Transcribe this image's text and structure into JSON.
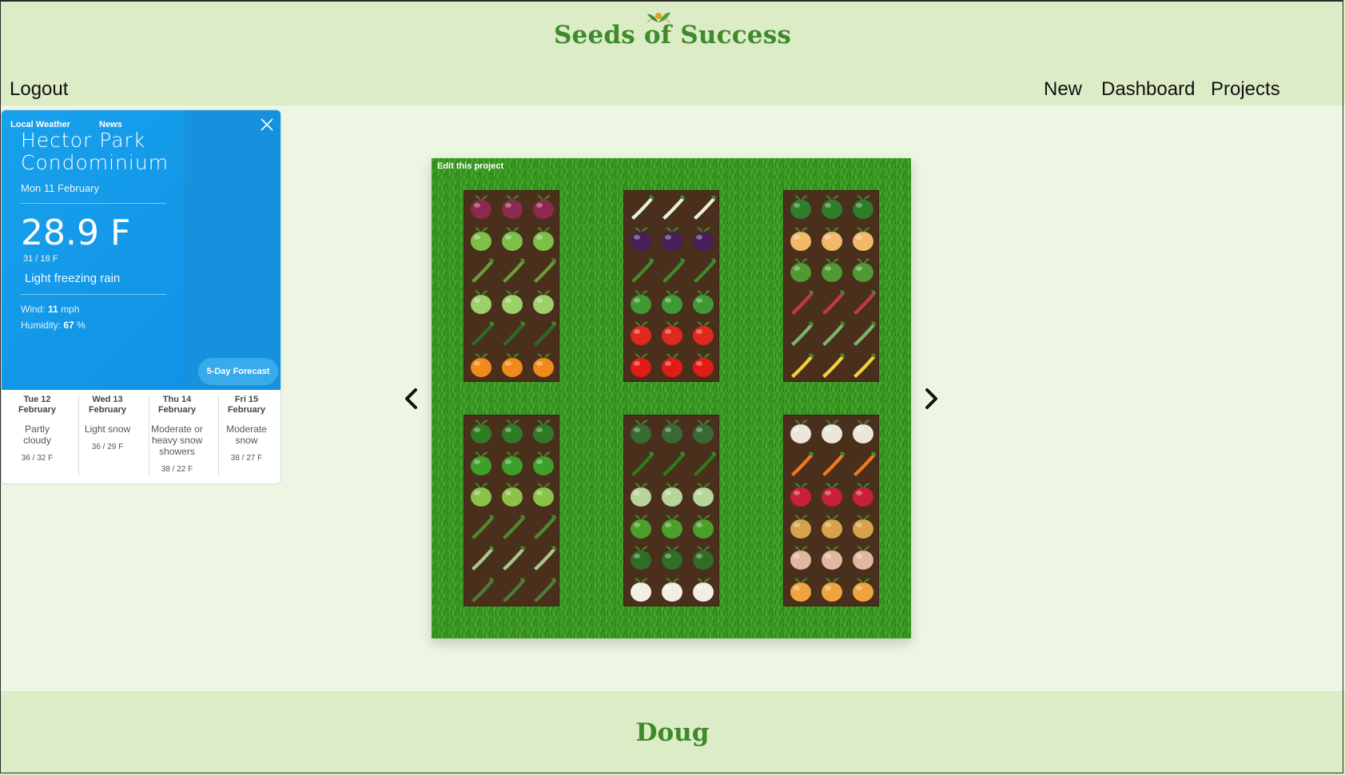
{
  "header": {
    "logo_text": "Seeds of Success",
    "nav": {
      "logout": "Logout",
      "new": "New",
      "dashboard": "Dashboard",
      "projects": "Projects"
    }
  },
  "weather": {
    "tabs": [
      "Local Weather",
      "News"
    ],
    "location": "Hector Park Condominium",
    "date": "Mon 11 February",
    "temperature": "28.9 F",
    "range": "31 / 18 F",
    "condition": "Light freezing rain",
    "wind_label": "Wind:",
    "wind_value": "11",
    "wind_unit": "mph",
    "humidity_label": "Humidity:",
    "humidity_value": "67",
    "humidity_unit": "%",
    "forecast_button": "5-Day Forecast",
    "forecast": [
      {
        "day": "Tue 12",
        "month": "February",
        "condition": "Partly cloudy",
        "range": "36 / 32 F"
      },
      {
        "day": "Wed 13",
        "month": "February",
        "condition": "Light snow",
        "range": "36 / 29 F"
      },
      {
        "day": "Thu 14",
        "month": "February",
        "condition": "Moderate or heavy snow showers",
        "range": "38 / 22 F"
      },
      {
        "day": "Fri 15",
        "month": "February",
        "condition": "Moderate snow",
        "range": "38 / 27 F"
      }
    ]
  },
  "project": {
    "edit_label": "Edit this project",
    "beds": [
      {
        "rows": [
          "beet",
          "bok-choy",
          "asparagus",
          "cabbage",
          "zucchini",
          "pumpkin"
        ]
      },
      {
        "rows": [
          "leek",
          "eggplant",
          "okra",
          "pea",
          "tomato",
          "bell-pepper"
        ]
      },
      {
        "rows": [
          "watermelon",
          "cantaloupe",
          "lettuce",
          "rhubarb",
          "chard",
          "corn"
        ]
      },
      {
        "rows": [
          "spinach",
          "basil",
          "leaf-lettuce",
          "parsley",
          "fennel",
          "rosemary"
        ]
      },
      {
        "rows": [
          "kale",
          "cucumber",
          "savoy-cabbage",
          "arugula",
          "broccoli",
          "cauliflower"
        ]
      },
      {
        "rows": [
          "garlic",
          "carrot",
          "radish",
          "potato",
          "ginger",
          "onion"
        ]
      }
    ],
    "colors": {
      "beet": "#8b2a4c",
      "bok-choy": "#7cc04a",
      "asparagus": "#6f9a3a",
      "cabbage": "#9bd06a",
      "zucchini": "#2f6a2a",
      "pumpkin": "#f08a1c",
      "leek": "#e8f0d8",
      "eggplant": "#4a1e5a",
      "okra": "#3f8a2a",
      "pea": "#3f9a34",
      "tomato": "#e0281c",
      "bell-pepper": "#e11c14",
      "watermelon": "#2e7d2a",
      "cantaloupe": "#f2b96a",
      "lettuce": "#4f9a32",
      "rhubarb": "#c23848",
      "chard": "#7fb36a",
      "corn": "#f2d23a",
      "spinach": "#2f7a24",
      "basil": "#3da02a",
      "leaf-lettuce": "#8ac24a",
      "parsley": "#4d8a2e",
      "fennel": "#a7c98a",
      "rosemary": "#4f7a3a",
      "kale": "#3a6a34",
      "cucumber": "#2f7a1e",
      "savoy-cabbage": "#b7d49a",
      "arugula": "#4aa02a",
      "broccoli": "#2f6e24",
      "cauliflower": "#f2efe2",
      "garlic": "#ece6d8",
      "carrot": "#f07a1c",
      "radish": "#c8203c",
      "potato": "#d8a24a",
      "ginger": "#e0b8a0",
      "onion": "#f0a440"
    }
  },
  "footer": {
    "user": "Doug"
  }
}
